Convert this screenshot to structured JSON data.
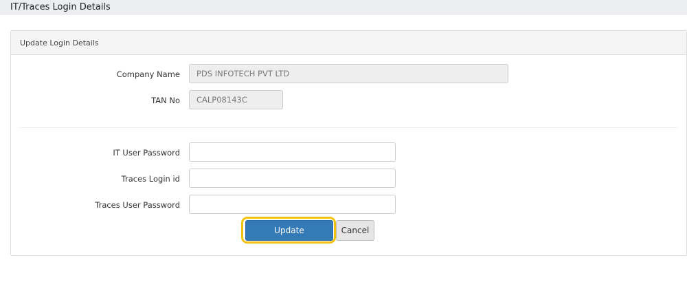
{
  "page_title": "IT/Traces Login Details",
  "panel_title": "Update Login Details",
  "fields": {
    "company_name": {
      "label": "Company Name",
      "value": "PDS INFOTECH PVT LTD"
    },
    "tan_no": {
      "label": "TAN No",
      "value": "CALP08143C"
    },
    "it_user_password": {
      "label": "IT User Password",
      "value": ""
    },
    "traces_login_id": {
      "label": "Traces Login id",
      "value": ""
    },
    "traces_user_password": {
      "label": "Traces User Password",
      "value": ""
    }
  },
  "buttons": {
    "update": "Update",
    "cancel": "Cancel"
  },
  "colors": {
    "primary": "#337ab7",
    "highlight": "#f4c20d"
  }
}
